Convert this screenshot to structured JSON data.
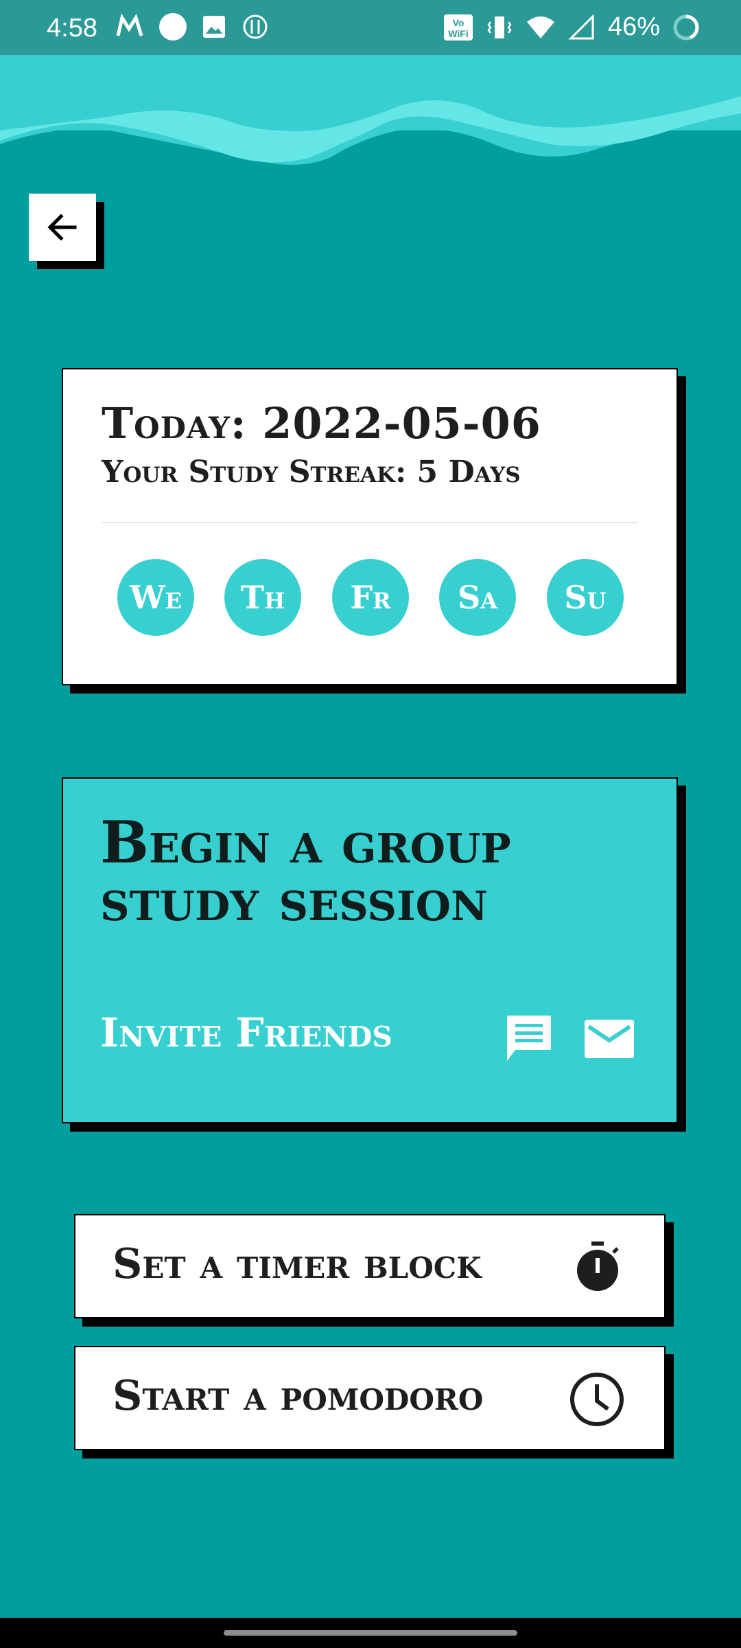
{
  "status_bar": {
    "time": "4:58",
    "battery": "46%",
    "icons": [
      "myntra-icon",
      "circle-notification-icon",
      "image-icon",
      "fork-knife-icon",
      "vowifi-icon",
      "vibrate-icon",
      "wifi-icon",
      "signal-icon",
      "battery-ring-icon"
    ]
  },
  "back_icon": "arrow-left-icon",
  "streak_card": {
    "today_label": "Today: 2022-05-06",
    "streak_label": "Your Study Streak: 5 Days",
    "days": [
      "We",
      "Th",
      "Fr",
      "Sa",
      "Su"
    ]
  },
  "group_card": {
    "title": "Begin a group study session",
    "invite_label": "Invite Friends",
    "icons": [
      "message-icon",
      "mail-icon"
    ]
  },
  "actions": {
    "timer_label": "Set a timer block",
    "timer_icon": "stopwatch-icon",
    "pomodoro_label": "Start a pomodoro",
    "pomodoro_icon": "clock-icon"
  },
  "colors": {
    "background": "#009e9c",
    "accent": "#38cfd0",
    "status_bar": "#2b9a96"
  }
}
